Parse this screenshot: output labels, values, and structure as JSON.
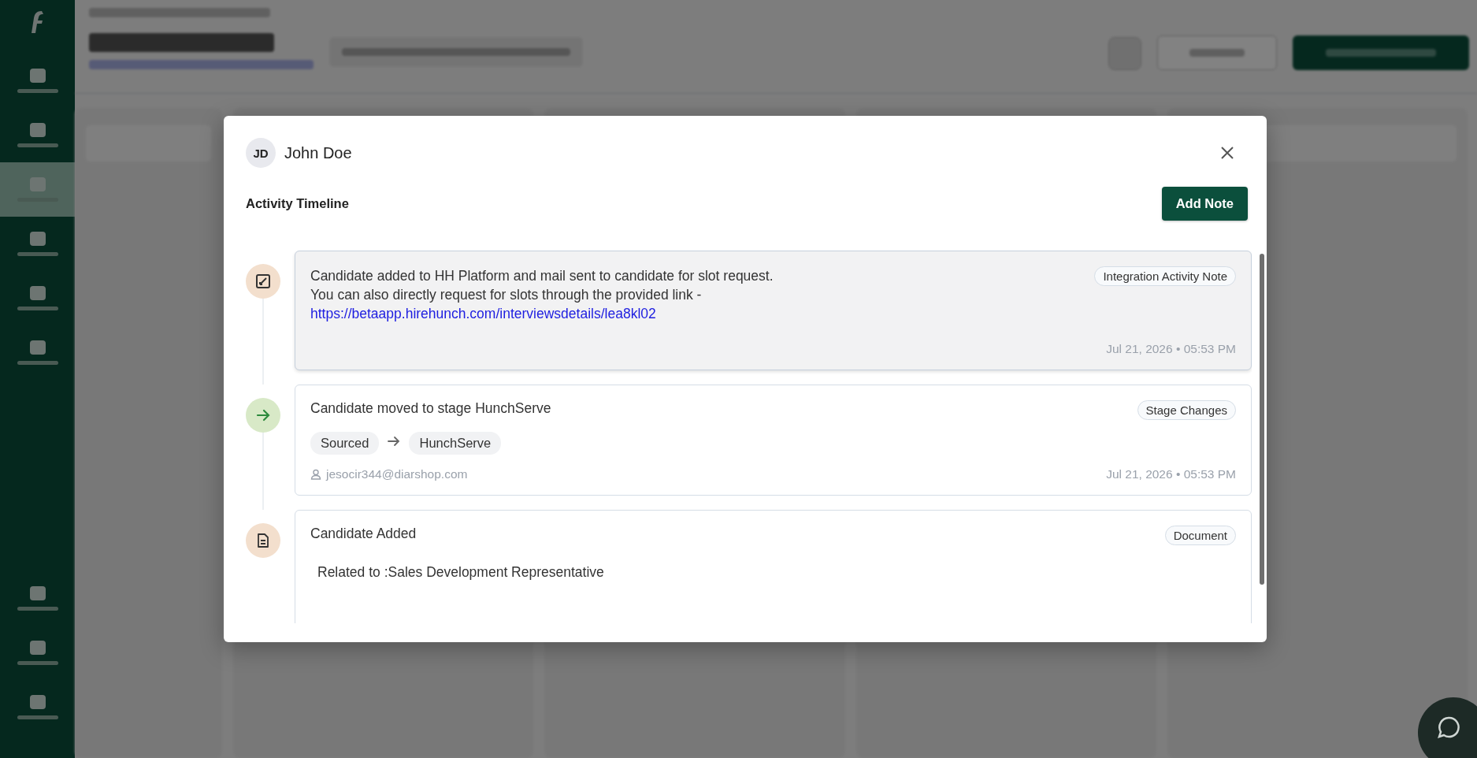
{
  "background": {
    "nav_items": [
      {
        "selected": false
      },
      {
        "selected": false
      },
      {
        "selected": true
      },
      {
        "selected": false
      },
      {
        "selected": false
      },
      {
        "selected": false
      }
    ],
    "nav_bottom": [
      {
        "selected": false
      },
      {
        "selected": false
      },
      {
        "selected": false
      }
    ]
  },
  "modal": {
    "candidate": {
      "initials": "JD",
      "name": "John Doe"
    },
    "section_title": "Activity Timeline",
    "add_note": "Add Note",
    "entries": [
      {
        "kind": "note",
        "highlighted": true,
        "lines": [
          "Candidate added to HH Platform and mail sent to candidate for slot request.",
          "You can also directly request for slots through the provided link -"
        ],
        "link": "https://betaapp.hirehunch.com/interviewsdetails/lea8kl02",
        "tag": "Integration Activity Note",
        "timestamp": "Jul 21, 2026 • 05:53 PM"
      },
      {
        "kind": "stage",
        "highlighted": false,
        "title": "Candidate moved to stage HunchServe",
        "from": "Sourced",
        "to": "HunchServe",
        "user": "jesocir344@diarshop.com",
        "tag": "Stage Changes",
        "timestamp": "Jul 21, 2026 • 05:53 PM"
      },
      {
        "kind": "document",
        "highlighted": false,
        "title": "Candidate Added",
        "related": "Related to :Sales Development Representative",
        "tag": "Document"
      }
    ]
  }
}
